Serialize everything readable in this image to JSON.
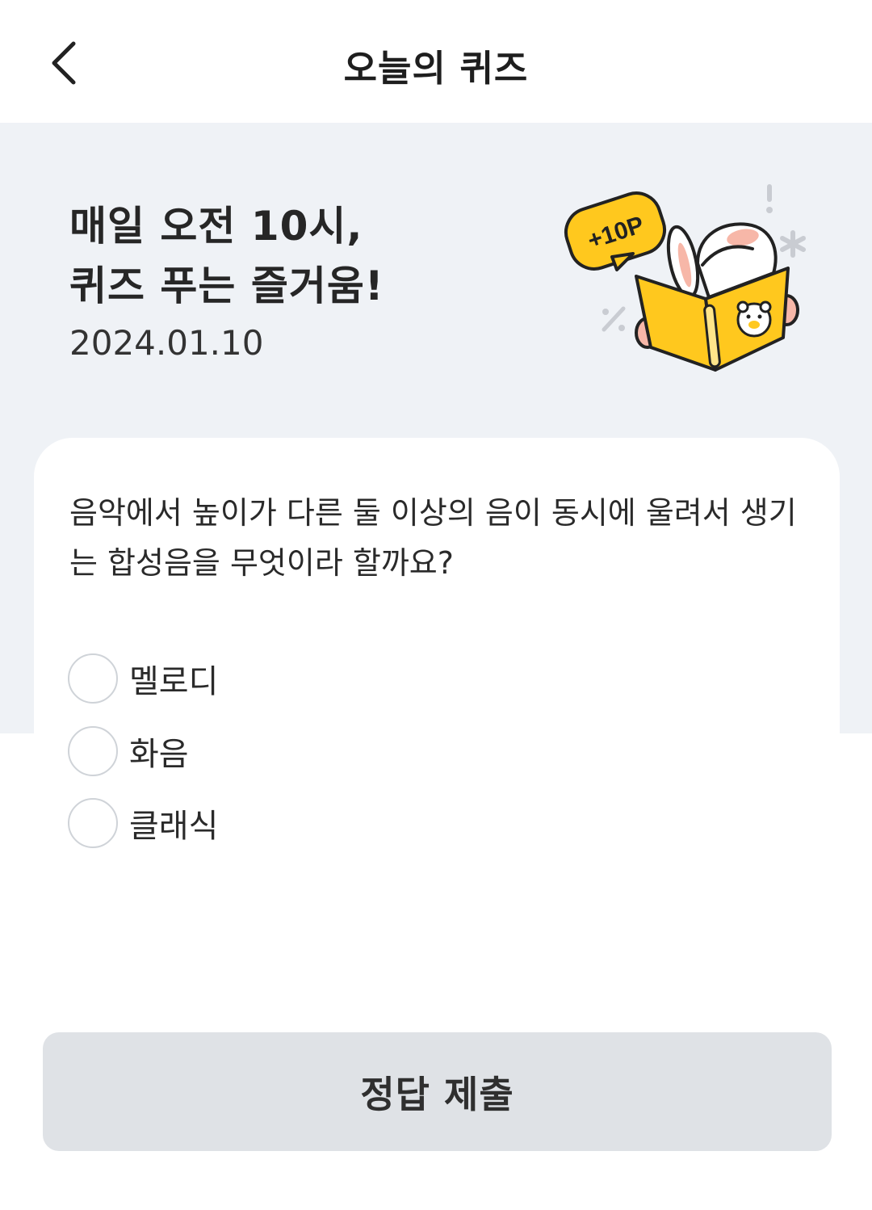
{
  "header": {
    "title": "오늘의 퀴즈",
    "back_icon": "chevron-left-icon"
  },
  "hero": {
    "line1": "매일 오전 10시,",
    "line2": "퀴즈 푸는 즐거움!",
    "date": "2024.01.10",
    "badge": "+10P",
    "accent_color": "#ffc81e",
    "background_color": "#eff2f6"
  },
  "quiz": {
    "question": "음악에서 높이가 다른 둘 이상의 음이 동시에 울려서 생기는 합성음을 무엇이라 할까요?",
    "options": [
      {
        "label": "멜로디"
      },
      {
        "label": "화음"
      },
      {
        "label": "클래식"
      }
    ]
  },
  "submit": {
    "label": "정답 제출"
  }
}
